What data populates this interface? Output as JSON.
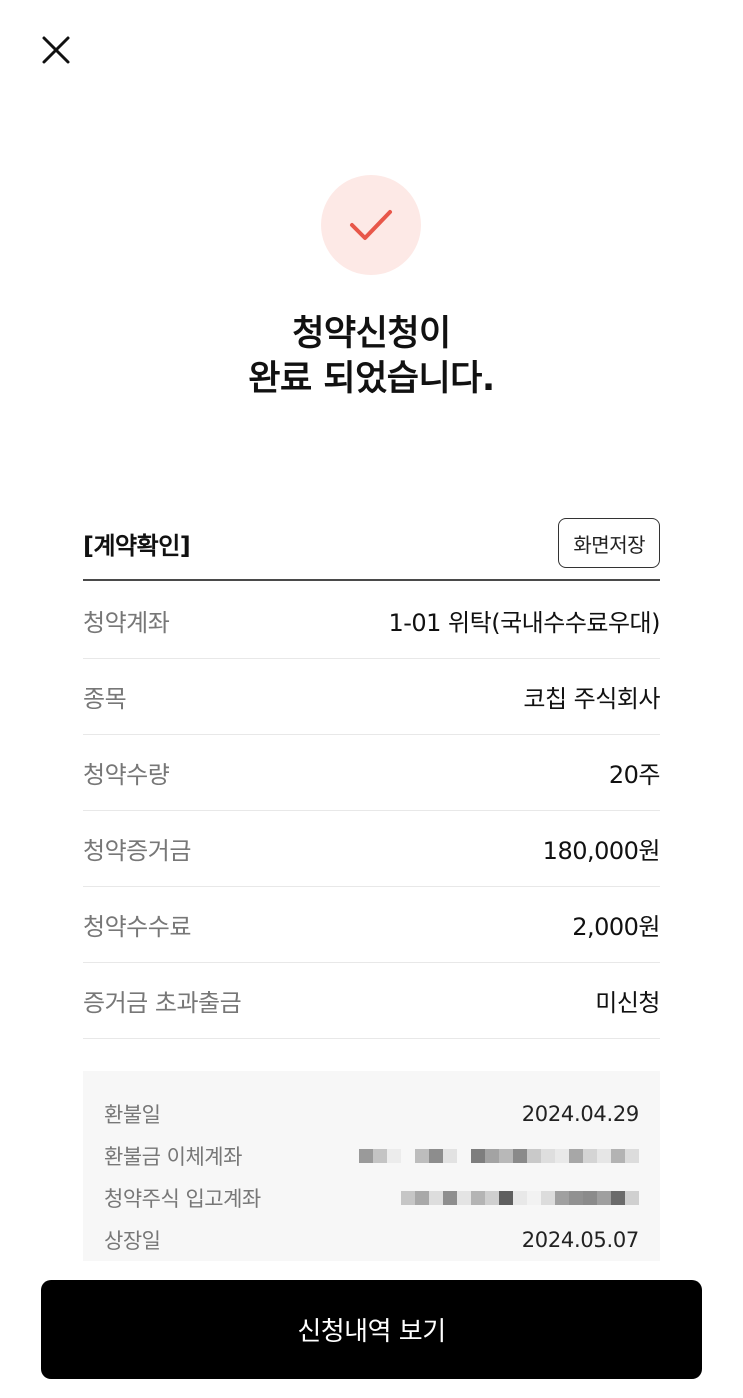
{
  "header": {
    "close_icon": "close-icon"
  },
  "status": {
    "icon": "check-icon",
    "icon_color": "#e8574a",
    "circle_color": "#fde9e6",
    "line1": "청약신청이",
    "line2": "완료 되었습니다."
  },
  "contract": {
    "title": "[계약확인]",
    "save_label": "화면저장",
    "rows": [
      {
        "label": "청약계좌",
        "value": "1-01 위탁(국내수수료우대)"
      },
      {
        "label": "종목",
        "value": "코칩 주식회사"
      },
      {
        "label": "청약수량",
        "value": "20주"
      },
      {
        "label": "청약증거금",
        "value": "180,000원"
      },
      {
        "label": "청약수수료",
        "value": "2,000원"
      },
      {
        "label": "증거금 초과출금",
        "value": "미신청"
      }
    ]
  },
  "info": {
    "refund_date_label": "환불일",
    "refund_date_value": "2024.04.29",
    "refund_account_label": "환불금 이체계좌",
    "stock_account_label": "청약주식 입고계좌",
    "listing_date_label": "상장일",
    "listing_date_value": "2024.05.07"
  },
  "footer": {
    "button_label": "신청내역 보기"
  }
}
